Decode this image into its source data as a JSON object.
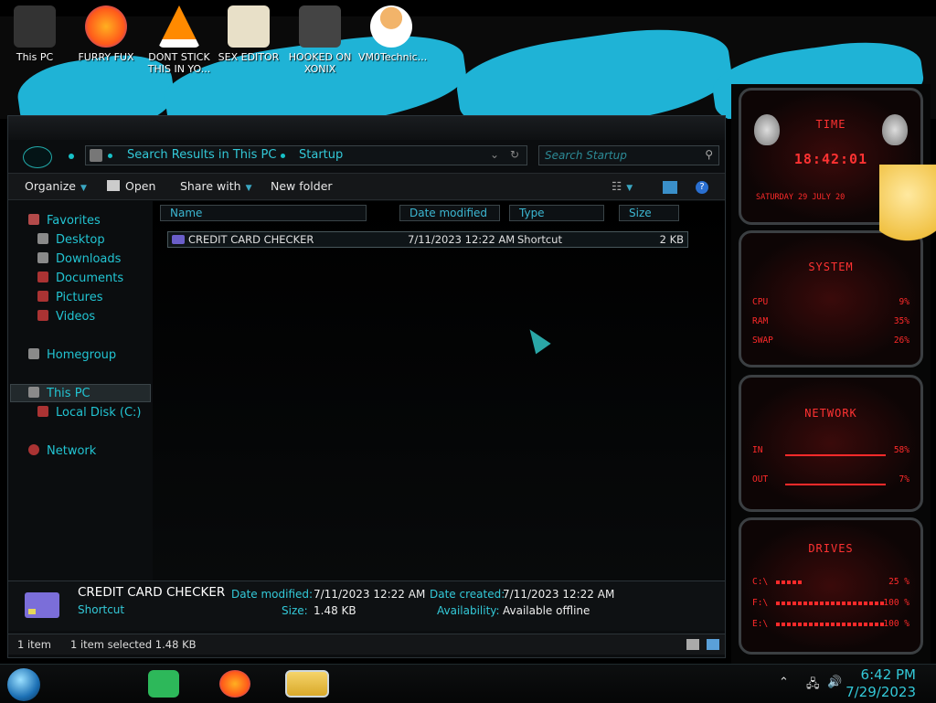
{
  "desktop": {
    "icons": [
      {
        "label": "This PC",
        "icon": "computer-icon"
      },
      {
        "label": "FURRY FUX",
        "icon": "firefox-icon"
      },
      {
        "label": "DONT STICK\nTHIS IN YO...",
        "icon": "vlc-icon"
      },
      {
        "label": "SEX EDITOR",
        "icon": "hxd-icon"
      },
      {
        "label": "HOOKED ON\nXONIX",
        "icon": "game-icon"
      },
      {
        "label": "VM0Technic...",
        "icon": "doctor-icon"
      }
    ],
    "accent": "#1fb3d6"
  },
  "explorer": {
    "address": {
      "segments": [
        "Search Results in This PC",
        "Startup"
      ]
    },
    "search": {
      "placeholder": "Search Startup"
    },
    "toolbar": {
      "organize": "Organize",
      "open": "Open",
      "share_with": "Share with",
      "new_folder": "New folder"
    },
    "sidebar": {
      "favorites": "Favorites",
      "desktop": "Desktop",
      "downloads": "Downloads",
      "documents": "Documents",
      "pictures": "Pictures",
      "videos": "Videos",
      "homegroup": "Homegroup",
      "this_pc": "This PC",
      "local_disk": "Local Disk (C:)",
      "network": "Network"
    },
    "columns": {
      "name": "Name",
      "date_modified": "Date modified",
      "type": "Type",
      "size": "Size"
    },
    "files": [
      {
        "name": "CREDIT CARD CHECKER",
        "date_modified": "7/11/2023 12:22 AM",
        "type": "Shortcut",
        "size": "2 KB"
      }
    ],
    "details": {
      "name": "CREDIT CARD CHECKER",
      "type": "Shortcut",
      "date_modified_label": "Date modified:",
      "date_modified": "7/11/2023 12:22 AM",
      "size_label": "Size:",
      "size": "1.48 KB",
      "date_created_label": "Date created:",
      "date_created": "7/11/2023 12:22 AM",
      "availability_label": "Availability:",
      "availability": "Available offline"
    },
    "status": {
      "items": "1 item",
      "selected": "1 item selected  1.48 KB"
    }
  },
  "gadgets": {
    "time": {
      "title": "TIME",
      "clock": "18:42:01",
      "date": "SATURDAY 29 JULY 20"
    },
    "system": {
      "title": "SYSTEM",
      "cpu_label": "CPU",
      "cpu": "9%",
      "ram_label": "RAM",
      "ram": "35%",
      "swap_label": "SWAP",
      "swap": "26%"
    },
    "network": {
      "title": "NETWORK",
      "in_label": "IN",
      "in": "58%",
      "out_label": "OUT",
      "out": "7%"
    },
    "drives": {
      "title": "DRIVES",
      "d1_label": "C:\\",
      "d1": "25 %",
      "d1_frac": 0.25,
      "d2_label": "F:\\",
      "d2": "100 %",
      "d2_frac": 1.0,
      "d3_label": "E:\\",
      "d3": "100 %",
      "d3_frac": 1.0
    },
    "accent": "#ff2a2a"
  },
  "taskbar": {
    "time": "6:42 PM",
    "date": "7/29/2023"
  }
}
